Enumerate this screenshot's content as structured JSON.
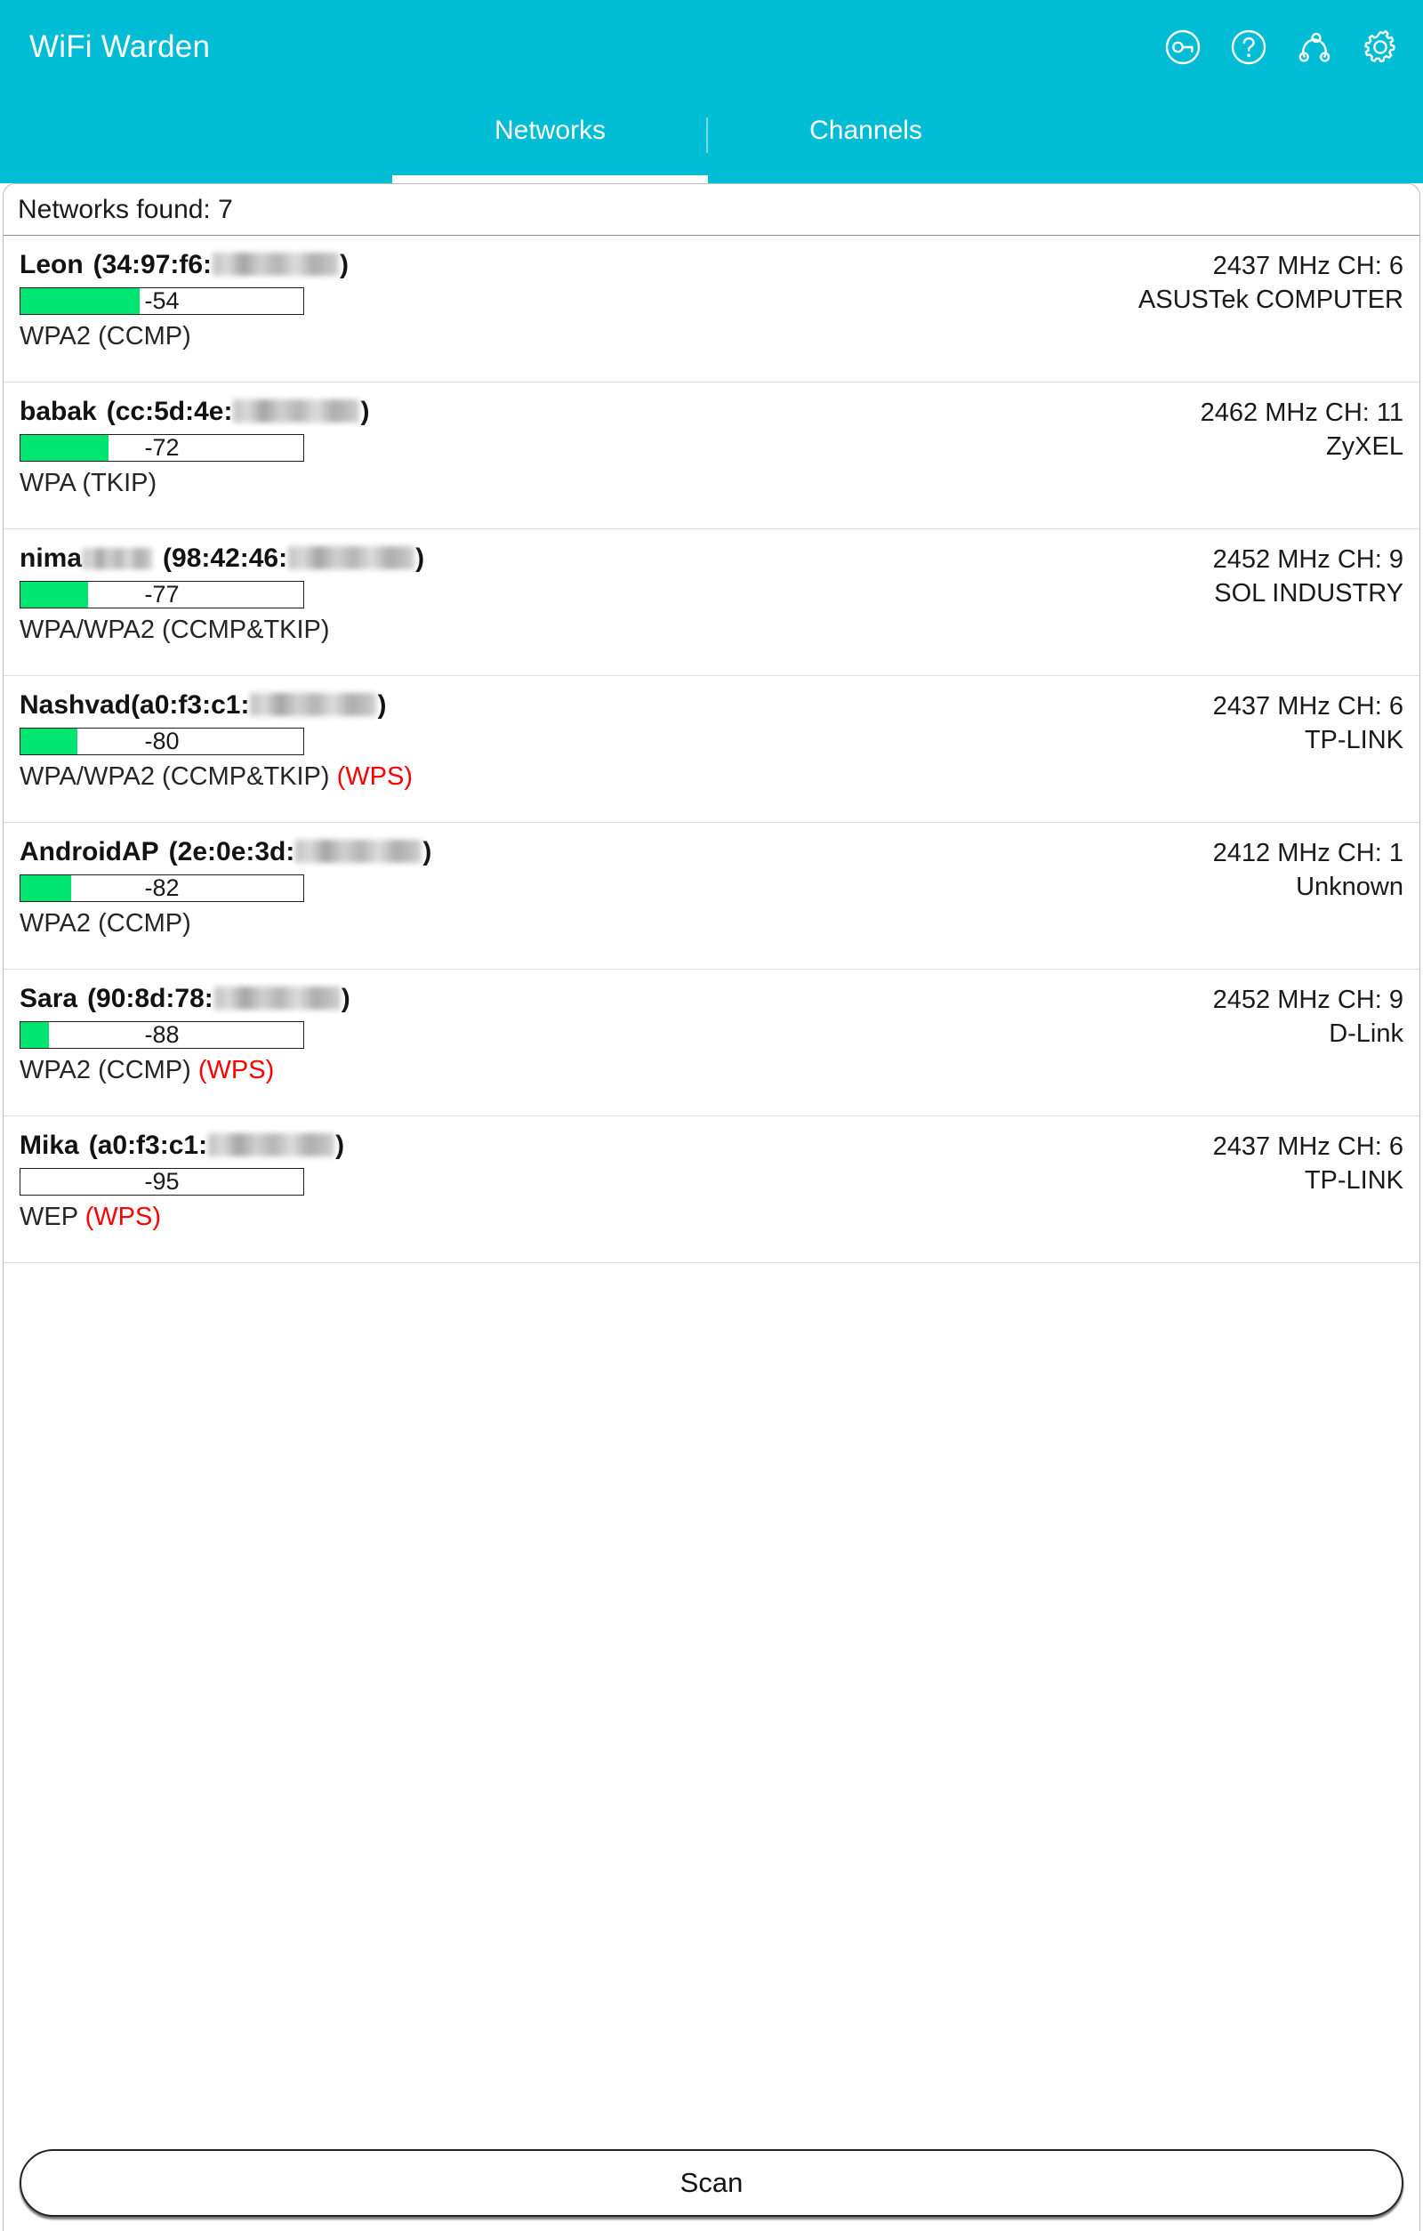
{
  "app": {
    "title": "WiFi Warden",
    "accent_color": "#00bcd4",
    "actions": [
      {
        "name": "key-icon",
        "label": "Key"
      },
      {
        "name": "help-icon",
        "label": "Help"
      },
      {
        "name": "share-network-icon",
        "label": "Share"
      },
      {
        "name": "gear-icon",
        "label": "Settings"
      }
    ]
  },
  "tabs": [
    {
      "label": "Networks",
      "active": true
    },
    {
      "label": "Channels",
      "active": false
    }
  ],
  "list_header": "Networks found: 7",
  "networks": [
    {
      "ssid": "Leon",
      "mac_prefix": "(34:97:f6:",
      "mac_suffix": ")",
      "signal": "-54",
      "signal_percent": 42,
      "security": "WPA2 (CCMP)",
      "wps": "",
      "frequency": "2437 MHz  CH: 6",
      "vendor": "ASUSTek COMPUTER"
    },
    {
      "ssid": "babak",
      "mac_prefix": "(cc:5d:4e:",
      "mac_suffix": ")",
      "signal": "-72",
      "signal_percent": 31,
      "security": "WPA (TKIP)",
      "wps": "",
      "frequency": "2462 MHz  CH: 11",
      "vendor": "ZyXEL"
    },
    {
      "ssid": "nima",
      "mac_prefix": "(98:42:46:",
      "mac_suffix": ")",
      "signal": "-77",
      "signal_percent": 24,
      "security": "WPA/WPA2 (CCMP&TKIP)",
      "wps": "",
      "frequency": "2452 MHz  CH: 9",
      "vendor": "SOL INDUSTRY"
    },
    {
      "ssid": "Nashvad",
      "mac_prefix": "(a0:f3:c1:",
      "mac_suffix": ")",
      "signal": "-80",
      "signal_percent": 20,
      "security": "WPA/WPA2 (CCMP&TKIP)",
      "wps": "(WPS)",
      "frequency": "2437 MHz  CH: 6",
      "vendor": "TP-LINK"
    },
    {
      "ssid": "AndroidAP",
      "mac_prefix": "(2e:0e:3d:",
      "mac_suffix": ")",
      "signal": "-82",
      "signal_percent": 18,
      "security": "WPA2 (CCMP)",
      "wps": "",
      "frequency": "2412 MHz  CH: 1",
      "vendor": "Unknown"
    },
    {
      "ssid": "Sara",
      "mac_prefix": "(90:8d:78:",
      "mac_suffix": ")",
      "signal": "-88",
      "signal_percent": 10,
      "security": "WPA2 (CCMP)",
      "wps": "(WPS)",
      "frequency": "2452 MHz  CH: 9",
      "vendor": "D-Link"
    },
    {
      "ssid": "Mika",
      "mac_prefix": "(a0:f3:c1:",
      "mac_suffix": ")",
      "signal": "-95",
      "signal_percent": 0,
      "security": "WEP",
      "wps": "(WPS)",
      "frequency": "2437 MHz  CH: 6",
      "vendor": "TP-LINK"
    }
  ],
  "scan_button": {
    "label": "Scan"
  },
  "colors": {
    "accent": "#00bcd4",
    "signal_green": "#00e472",
    "wps_red": "#ff0000"
  }
}
